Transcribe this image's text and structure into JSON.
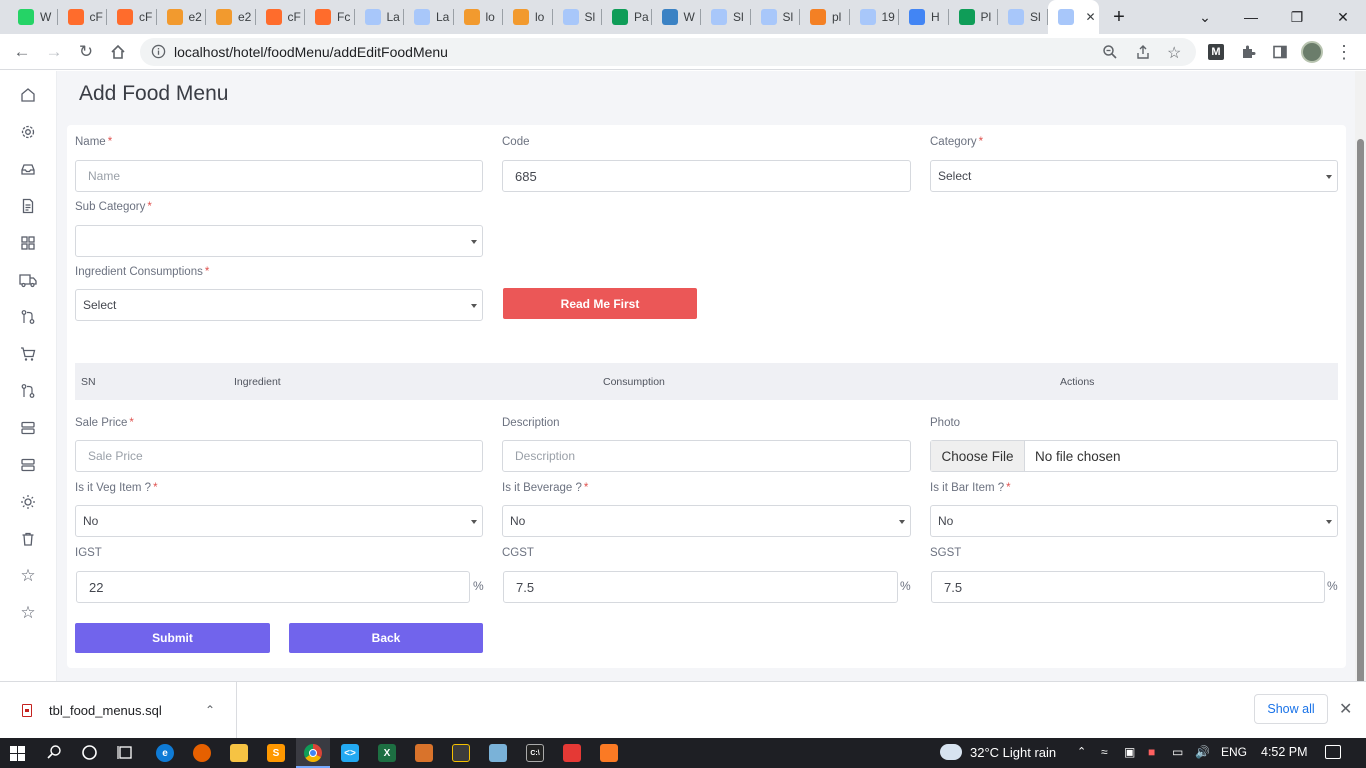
{
  "browser": {
    "tabs": [
      {
        "label": "W",
        "icon": "whatsapp-icon",
        "color": "#25d366"
      },
      {
        "label": "cF",
        "icon": "cpanel-icon",
        "color": "#ff6c2c"
      },
      {
        "label": "cF",
        "icon": "cpanel-icon",
        "color": "#ff6c2c"
      },
      {
        "label": "e2",
        "icon": "phpmyadmin-icon",
        "color": "#f29a2e"
      },
      {
        "label": "e2",
        "icon": "phpmyadmin-icon",
        "color": "#f29a2e"
      },
      {
        "label": "cF",
        "icon": "cpanel-icon",
        "color": "#ff6c2c"
      },
      {
        "label": "Fc",
        "icon": "cpanel-icon",
        "color": "#ff6c2c"
      },
      {
        "label": "La",
        "icon": "app-icon",
        "color": "#a8c7fa"
      },
      {
        "label": "La",
        "icon": "app-icon",
        "color": "#a8c7fa"
      },
      {
        "label": "lo",
        "icon": "phpmyadmin-icon",
        "color": "#f29a2e"
      },
      {
        "label": "lo",
        "icon": "phpmyadmin-icon",
        "color": "#f29a2e"
      },
      {
        "label": "Sl",
        "icon": "app-icon",
        "color": "#a8c7fa"
      },
      {
        "label": "Pa",
        "icon": "sheets-plus-icon",
        "color": "#0f9d58"
      },
      {
        "label": "W",
        "icon": "cube-icon",
        "color": "#3b82c4"
      },
      {
        "label": "Sl",
        "icon": "app-icon",
        "color": "#a8c7fa"
      },
      {
        "label": "Sl",
        "icon": "app-icon",
        "color": "#a8c7fa"
      },
      {
        "label": "pl",
        "icon": "stackoverflow-icon",
        "color": "#f48024"
      },
      {
        "label": "19",
        "icon": "app-icon",
        "color": "#a8c7fa"
      },
      {
        "label": "H",
        "icon": "google-icon",
        "color": "#4285f4"
      },
      {
        "label": "Pl",
        "icon": "sheets-s-icon",
        "color": "#0f9d58"
      },
      {
        "label": "Sl",
        "icon": "app-icon",
        "color": "#a8c7fa"
      },
      {
        "label": "",
        "icon": "app-icon",
        "color": "#a8c7fa"
      }
    ],
    "url": "localhost/hotel/foodMenu/addEditFoodMenu"
  },
  "page": {
    "title": "Add Food Menu",
    "form": {
      "name": {
        "label": "Name",
        "required": "*",
        "placeholder": "Name"
      },
      "code": {
        "label": "Code",
        "value": "685"
      },
      "category": {
        "label": "Category",
        "required": "*",
        "value": "Select"
      },
      "sub_category": {
        "label": "Sub Category",
        "required": "*",
        "value": ""
      },
      "ingredient_consumptions": {
        "label": "Ingredient Consumptions",
        "required": "*",
        "value": "Select"
      },
      "read_me_first": "Read Me First",
      "table_headers": {
        "sn": "SN",
        "ingredient": "Ingredient",
        "consumption": "Consumption",
        "actions": "Actions"
      },
      "sale_price": {
        "label": "Sale Price",
        "required": "*",
        "placeholder": "Sale Price"
      },
      "description": {
        "label": "Description",
        "placeholder": "Description"
      },
      "photo": {
        "label": "Photo",
        "choose_file": "Choose File",
        "no_file": "No file chosen"
      },
      "veg_item": {
        "label": "Is it Veg Item ?",
        "required": "*",
        "value": "No"
      },
      "beverage": {
        "label": "Is it Beverage ?",
        "required": "*",
        "value": "No"
      },
      "bar_item": {
        "label": "Is it Bar Item ?",
        "required": "*",
        "value": "No"
      },
      "igst": {
        "label": "IGST",
        "value": "22",
        "unit": "%"
      },
      "cgst": {
        "label": "CGST",
        "value": "7.5",
        "unit": "%"
      },
      "sgst": {
        "label": "SGST",
        "value": "7.5",
        "unit": "%"
      },
      "submit": "Submit",
      "back": "Back"
    }
  },
  "downloads": {
    "file": "tbl_food_menus.sql",
    "show_all": "Show all"
  },
  "taskbar": {
    "weather": "32°C  Light rain",
    "lang": "ENG",
    "time": "4:52 PM"
  }
}
